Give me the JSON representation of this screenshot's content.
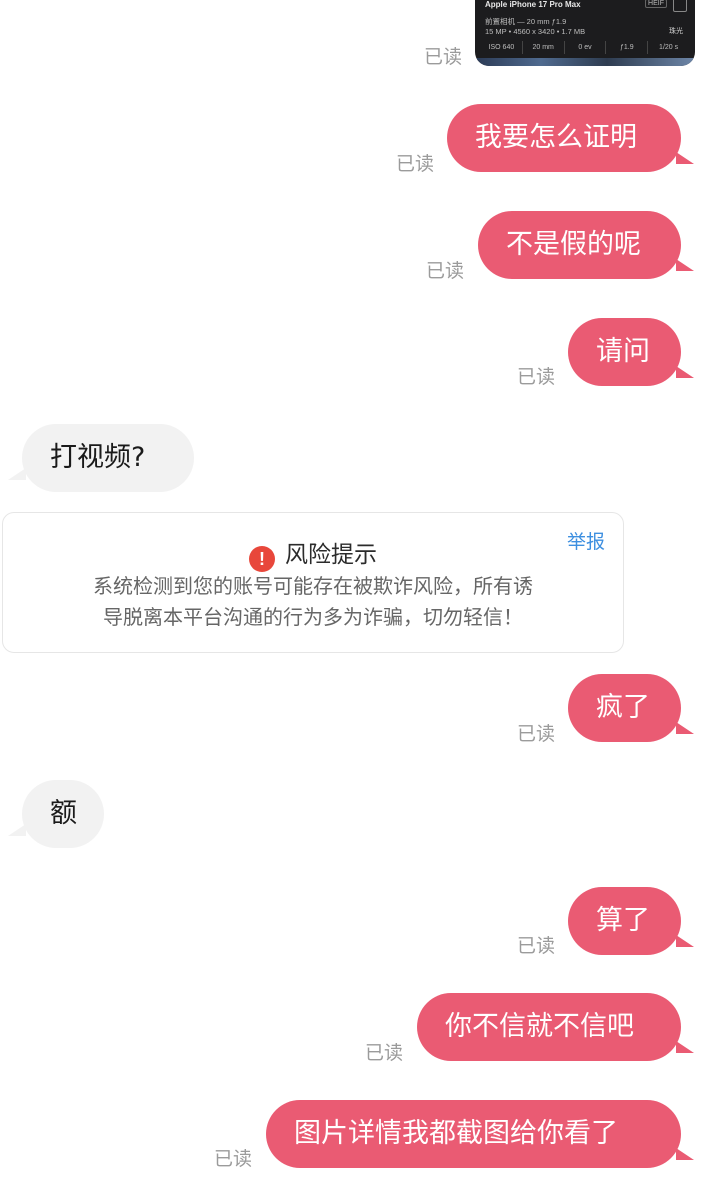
{
  "photo_card": {
    "device": "Apple iPhone 17 Pro Max",
    "format": "HEIF",
    "lens": "前置相机 — 20 mm ƒ1.9",
    "meta": "15 MP • 4560 x 3420 • 1.7 MB",
    "tag": "珠光",
    "specs": [
      "ISO 640",
      "20 mm",
      "0 ev",
      "ƒ1.9",
      "1/20 s"
    ]
  },
  "messages": [
    {
      "side": "out",
      "text": "我要怎么证明",
      "status": "已读"
    },
    {
      "side": "out",
      "text": "不是假的呢",
      "status": "已读"
    },
    {
      "side": "out",
      "text": "请问",
      "status": "已读"
    },
    {
      "side": "in",
      "text": "打视频?"
    },
    {
      "side": "out",
      "text": "疯了",
      "status": "已读"
    },
    {
      "side": "in",
      "text": "额"
    },
    {
      "side": "out",
      "text": "算了",
      "status": "已读"
    },
    {
      "side": "out",
      "text": "你不信就不信吧",
      "status": "已读"
    },
    {
      "side": "out",
      "text": "图片详情我都截图给你看了",
      "status": "已读"
    }
  ],
  "photo_status": "已读",
  "risk_notice": {
    "icon": "exclamation-icon",
    "title": "风险提示",
    "body_line1": "系统检测到您的账号可能存在被欺诈风险，所有诱",
    "body_line2": "导脱离本平台沟通的行为多为诈骗，切勿轻信！",
    "report_label": "举报"
  },
  "colors": {
    "outgoing_bubble": "#ea5b73",
    "incoming_bubble": "#f2f2f2",
    "read_status": "#9b9b9b",
    "warning_icon": "#e8473b",
    "report_link": "#3d8fe0"
  }
}
